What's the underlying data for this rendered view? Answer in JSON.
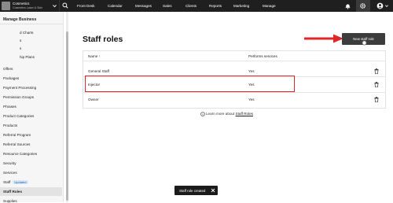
{
  "brand": {
    "name": "Cosmetics",
    "subtitle": "Cosmetics Laser & Skin"
  },
  "nav": {
    "items": [
      "Front Desk",
      "Calendar",
      "Messages",
      "Sales",
      "Clients",
      "Reports",
      "Marketing",
      "Manage"
    ]
  },
  "sidebar": {
    "title": "Manage Business",
    "cut_items": [
      "d Charts",
      "s",
      "s",
      "hip Plans"
    ],
    "items": [
      "Offers",
      "Packages",
      "Payment Processing",
      "Permission Groups",
      "Phrases",
      "Product Categories",
      "Products",
      "Referral Program",
      "Referral Sources",
      "Resource Categories",
      "Security",
      "Services",
      "Staff",
      "Staff Roles",
      "Supplies"
    ],
    "staff_badge": "Updated",
    "active": "Staff Roles"
  },
  "page": {
    "title": "Staff roles",
    "new_button": "New staff role"
  },
  "table": {
    "columns": [
      "Name",
      "Performs services"
    ],
    "rows": [
      {
        "name": "General Staff",
        "performs": "Yes"
      },
      {
        "name": "Injector",
        "performs": "Yes"
      },
      {
        "name": "Owner",
        "performs": "Yes"
      }
    ]
  },
  "learn_more": {
    "prefix": "Learn more about",
    "link": "Staff Roles"
  },
  "toast": {
    "text": "Staff role created"
  },
  "colors": {
    "topbar": "#1f1f1f",
    "highlight": "#e02626",
    "button": "#3c3c3c",
    "badge": "#d7e7fa"
  }
}
